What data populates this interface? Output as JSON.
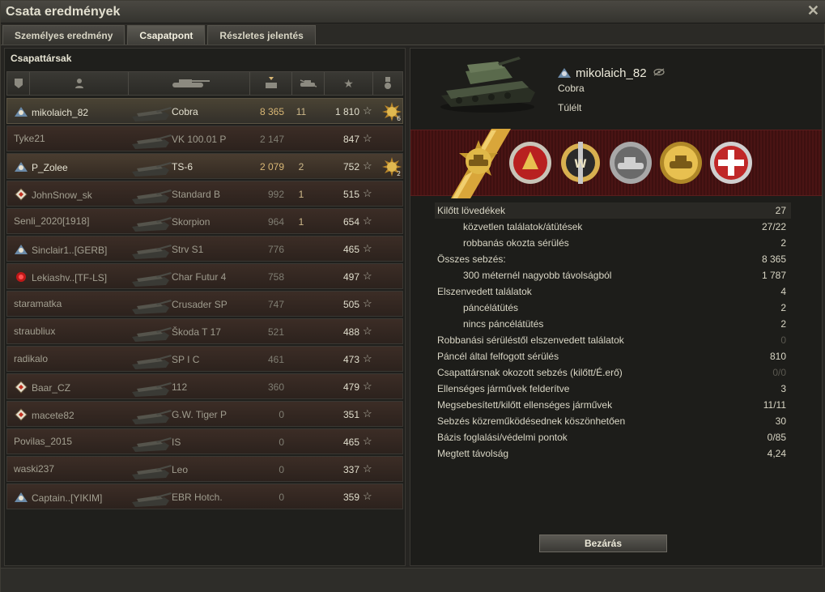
{
  "window": {
    "title": "Csata eredmények",
    "close_symbol": "✕"
  },
  "tabs": [
    {
      "label": "Személyes eredmény",
      "active": false
    },
    {
      "label": "Csapatpont",
      "active": true
    },
    {
      "label": "Részletes jelentés",
      "active": false
    }
  ],
  "team": {
    "title": "Csapattársak",
    "rows": [
      {
        "player": "mikolaich_82",
        "tank": "Cobra",
        "damage": "8 365",
        "kills": "11",
        "xp": "1 810",
        "medal": "6",
        "icon": "clan-icon",
        "style": "self"
      },
      {
        "player": "Tyke21",
        "tank": "VK 100.01 P",
        "damage": "2 147",
        "kills": "",
        "xp": "847",
        "medal": "",
        "icon": "",
        "style": "alt"
      },
      {
        "player": "P_Zolee",
        "tank": "TS-6",
        "damage": "2 079",
        "kills": "2",
        "xp": "752",
        "medal": "2",
        "icon": "clan-icon",
        "style": "plt"
      },
      {
        "player": "JohnSnow_sk",
        "tank": "Standard B",
        "damage": "992",
        "kills": "1",
        "xp": "515",
        "medal": "",
        "icon": "diamond-icon",
        "style": "alt"
      },
      {
        "player": "Senli_2020[1918]",
        "tank": "Skorpion",
        "damage": "964",
        "kills": "1",
        "xp": "654",
        "medal": "",
        "icon": "",
        "style": "alt"
      },
      {
        "player": "Sinclair1..[GERB]",
        "tank": "Strv S1",
        "damage": "776",
        "kills": "",
        "xp": "465",
        "medal": "",
        "icon": "clan-icon",
        "style": "alt"
      },
      {
        "player": "Lekiashv..[TF-LS]",
        "tank": "Char Futur 4",
        "damage": "758",
        "kills": "",
        "xp": "497",
        "medal": "",
        "icon": "rose-icon",
        "style": "alt"
      },
      {
        "player": "staramatka",
        "tank": "Crusader SP",
        "damage": "747",
        "kills": "",
        "xp": "505",
        "medal": "",
        "icon": "",
        "style": "alt"
      },
      {
        "player": "straubliux",
        "tank": "Škoda T 17",
        "damage": "521",
        "kills": "",
        "xp": "488",
        "medal": "",
        "icon": "",
        "style": "alt"
      },
      {
        "player": "radikalo",
        "tank": "SP I C",
        "damage": "461",
        "kills": "",
        "xp": "473",
        "medal": "",
        "icon": "",
        "style": "alt"
      },
      {
        "player": "Baar_CZ",
        "tank": "112",
        "damage": "360",
        "kills": "",
        "xp": "479",
        "medal": "",
        "icon": "diamond-icon",
        "style": "alt"
      },
      {
        "player": "macete82",
        "tank": "G.W. Tiger P",
        "damage": "0",
        "kills": "",
        "xp": "351",
        "medal": "",
        "icon": "diamond-icon",
        "style": "alt"
      },
      {
        "player": "Povilas_2015",
        "tank": "IS",
        "damage": "0",
        "kills": "",
        "xp": "465",
        "medal": "",
        "icon": "",
        "style": "alt"
      },
      {
        "player": "waski237",
        "tank": "Leo",
        "damage": "0",
        "kills": "",
        "xp": "337",
        "medal": "",
        "icon": "",
        "style": "alt"
      },
      {
        "player": "Captain..[YIKIM]",
        "tank": "EBR Hotch.",
        "damage": "0",
        "kills": "",
        "xp": "359",
        "medal": "",
        "icon": "clan-icon",
        "style": "alt"
      }
    ]
  },
  "detail": {
    "player": "mikolaich_82",
    "tank": "Cobra",
    "status": "Túlélt",
    "stats": [
      {
        "label": "Kilőtt lövedékek",
        "value": "27",
        "indent": false,
        "dim": false
      },
      {
        "label": "közvetlen találatok/átütések",
        "value": "27/22",
        "indent": true,
        "dim": false
      },
      {
        "label": "robbanás okozta sérülés",
        "value": "2",
        "indent": true,
        "dim": false
      },
      {
        "label": "Összes sebzés:",
        "value": "8 365",
        "indent": false,
        "dim": false
      },
      {
        "label": "300 méternél nagyobb távolságból",
        "value": "1 787",
        "indent": true,
        "dim": false
      },
      {
        "label": "Elszenvedett találatok",
        "value": "4",
        "indent": false,
        "dim": false
      },
      {
        "label": "páncélátütés",
        "value": "2",
        "indent": true,
        "dim": false
      },
      {
        "label": "nincs páncélátütés",
        "value": "2",
        "indent": true,
        "dim": false
      },
      {
        "label": "Robbanási sérüléstől elszenvedett találatok",
        "value": "0",
        "indent": false,
        "dim": true
      },
      {
        "label": "Páncél által felfogott sérülés",
        "value": "810",
        "indent": false,
        "dim": false
      },
      {
        "label": "Csapattársnak okozott sebzés (kilőtt/É.erő)",
        "value": "0/0",
        "indent": false,
        "dim": true
      },
      {
        "label": "Ellenséges járművek felderítve",
        "value": "3",
        "indent": false,
        "dim": false
      },
      {
        "label": "Megsebesített/kilőtt ellenséges járművek",
        "value": "11/11",
        "indent": false,
        "dim": false
      },
      {
        "label": "Sebzés közreműködésednek köszönhetően",
        "value": "30",
        "indent": false,
        "dim": false
      },
      {
        "label": "Bázis foglalási/védelmi pontok",
        "value": "0/85",
        "indent": false,
        "dim": false
      },
      {
        "label": "Megtett távolság",
        "value": "4,24",
        "indent": false,
        "dim": false
      }
    ],
    "close_label": "Bezárás"
  },
  "colors": {
    "ribbon": "#4a1414",
    "gold": "#d9a63a",
    "text": "#d9d6c5"
  }
}
